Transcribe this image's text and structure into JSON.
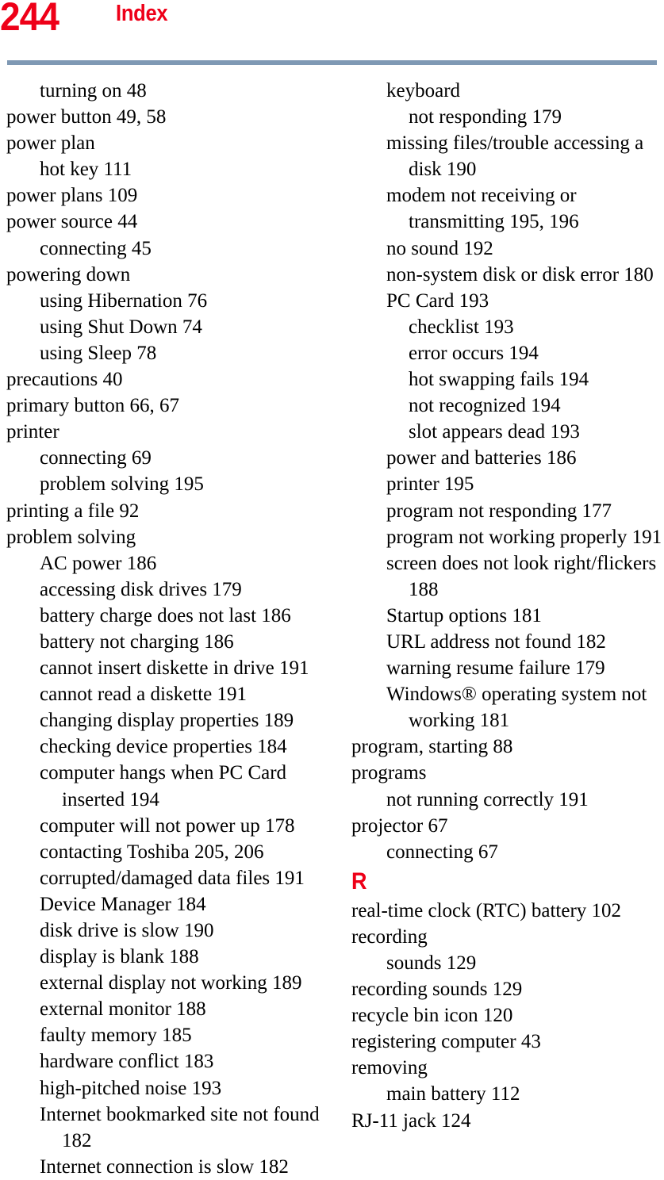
{
  "header": {
    "page_number": "244",
    "title": "Index",
    "number_color": "#ee0018",
    "title_color": "#ee0018",
    "rule_color": "#7f99b4"
  },
  "columns": {
    "left": [
      {
        "level": 1,
        "text": "turning on 48"
      },
      {
        "level": 0,
        "text": "power button 49, 58"
      },
      {
        "level": 0,
        "text": "power plan"
      },
      {
        "level": 1,
        "text": "hot key 111"
      },
      {
        "level": 0,
        "text": "power plans 109"
      },
      {
        "level": 0,
        "text": "power source 44"
      },
      {
        "level": 1,
        "text": "connecting 45"
      },
      {
        "level": 0,
        "text": "powering down"
      },
      {
        "level": 1,
        "text": "using Hibernation 76"
      },
      {
        "level": 1,
        "text": "using Shut Down 74"
      },
      {
        "level": 1,
        "text": "using Sleep 78"
      },
      {
        "level": 0,
        "text": "precautions 40"
      },
      {
        "level": 0,
        "text": "primary button 66, 67"
      },
      {
        "level": 0,
        "text": "printer"
      },
      {
        "level": 1,
        "text": "connecting 69"
      },
      {
        "level": 1,
        "text": "problem solving 195"
      },
      {
        "level": 0,
        "text": "printing a file 92"
      },
      {
        "level": 0,
        "text": "problem solving"
      },
      {
        "level": 1,
        "text": "AC power 186"
      },
      {
        "level": 1,
        "text": "accessing disk drives 179"
      },
      {
        "level": 1,
        "text": "battery charge does not last 186"
      },
      {
        "level": 1,
        "text": "battery not charging 186"
      },
      {
        "level": 1,
        "text": "cannot insert diskette in drive 191"
      },
      {
        "level": 1,
        "text": "cannot read a diskette 191"
      },
      {
        "level": 1,
        "text": "changing display properties 189"
      },
      {
        "level": 1,
        "text": "checking device properties 184"
      },
      {
        "level": 1,
        "text": "computer hangs when PC Card inserted 194"
      },
      {
        "level": 1,
        "text": "computer will not power up 178"
      },
      {
        "level": 1,
        "text": "contacting Toshiba 205, 206"
      },
      {
        "level": 1,
        "text": "corrupted/damaged data files 191"
      },
      {
        "level": 1,
        "text": "Device Manager 184"
      },
      {
        "level": 1,
        "text": "disk drive is slow 190"
      },
      {
        "level": 1,
        "text": "display is blank 188"
      },
      {
        "level": 1,
        "text": "external display not working 189"
      },
      {
        "level": 1,
        "text": "external monitor 188"
      },
      {
        "level": 1,
        "text": "faulty memory 185"
      },
      {
        "level": 1,
        "text": "hardware conflict 183"
      },
      {
        "level": 1,
        "text": "high-pitched noise 193"
      },
      {
        "level": 1,
        "text": "Internet bookmarked site not found 182"
      },
      {
        "level": 1,
        "text": "Internet connection is slow 182"
      }
    ],
    "right": [
      {
        "level": 1,
        "text": "keyboard"
      },
      {
        "level": 2,
        "text": "not responding 179"
      },
      {
        "level": 1,
        "text": "missing files/trouble accessing a disk 190"
      },
      {
        "level": 1,
        "text": "modem not receiving or transmitting 195, 196"
      },
      {
        "level": 1,
        "text": "no sound 192"
      },
      {
        "level": 1,
        "text": "non-system disk or disk error 180"
      },
      {
        "level": 1,
        "text": "PC Card 193"
      },
      {
        "level": 2,
        "text": "checklist 193"
      },
      {
        "level": 2,
        "text": "error occurs 194"
      },
      {
        "level": 2,
        "text": "hot swapping fails 194"
      },
      {
        "level": 2,
        "text": "not recognized 194"
      },
      {
        "level": 2,
        "text": "slot appears dead 193"
      },
      {
        "level": 1,
        "text": "power and batteries 186"
      },
      {
        "level": 1,
        "text": "printer 195"
      },
      {
        "level": 1,
        "text": "program not responding 177"
      },
      {
        "level": 1,
        "text": "program not working properly 191"
      },
      {
        "level": 1,
        "text": "screen does not look right/flickers 188"
      },
      {
        "level": 1,
        "text": "Startup options 181"
      },
      {
        "level": 1,
        "text": "URL address not found 182"
      },
      {
        "level": 1,
        "text": "warning resume failure 179"
      },
      {
        "level": 1,
        "text": "Windows® operating system not working 181"
      },
      {
        "level": 0,
        "text": "program, starting 88"
      },
      {
        "level": 0,
        "text": "programs"
      },
      {
        "level": 1,
        "text": "not running correctly 191"
      },
      {
        "level": 0,
        "text": "projector 67"
      },
      {
        "level": 1,
        "text": "connecting 67"
      },
      {
        "level": "heading",
        "text": "R"
      },
      {
        "level": 0,
        "text": "real-time clock (RTC) battery 102"
      },
      {
        "level": 0,
        "text": "recording"
      },
      {
        "level": 1,
        "text": "sounds 129"
      },
      {
        "level": 0,
        "text": "recording sounds 129"
      },
      {
        "level": 0,
        "text": "recycle bin icon 120"
      },
      {
        "level": 0,
        "text": "registering computer 43"
      },
      {
        "level": 0,
        "text": "removing"
      },
      {
        "level": 1,
        "text": "main battery 112"
      },
      {
        "level": 0,
        "text": "RJ-11 jack 124"
      }
    ]
  }
}
